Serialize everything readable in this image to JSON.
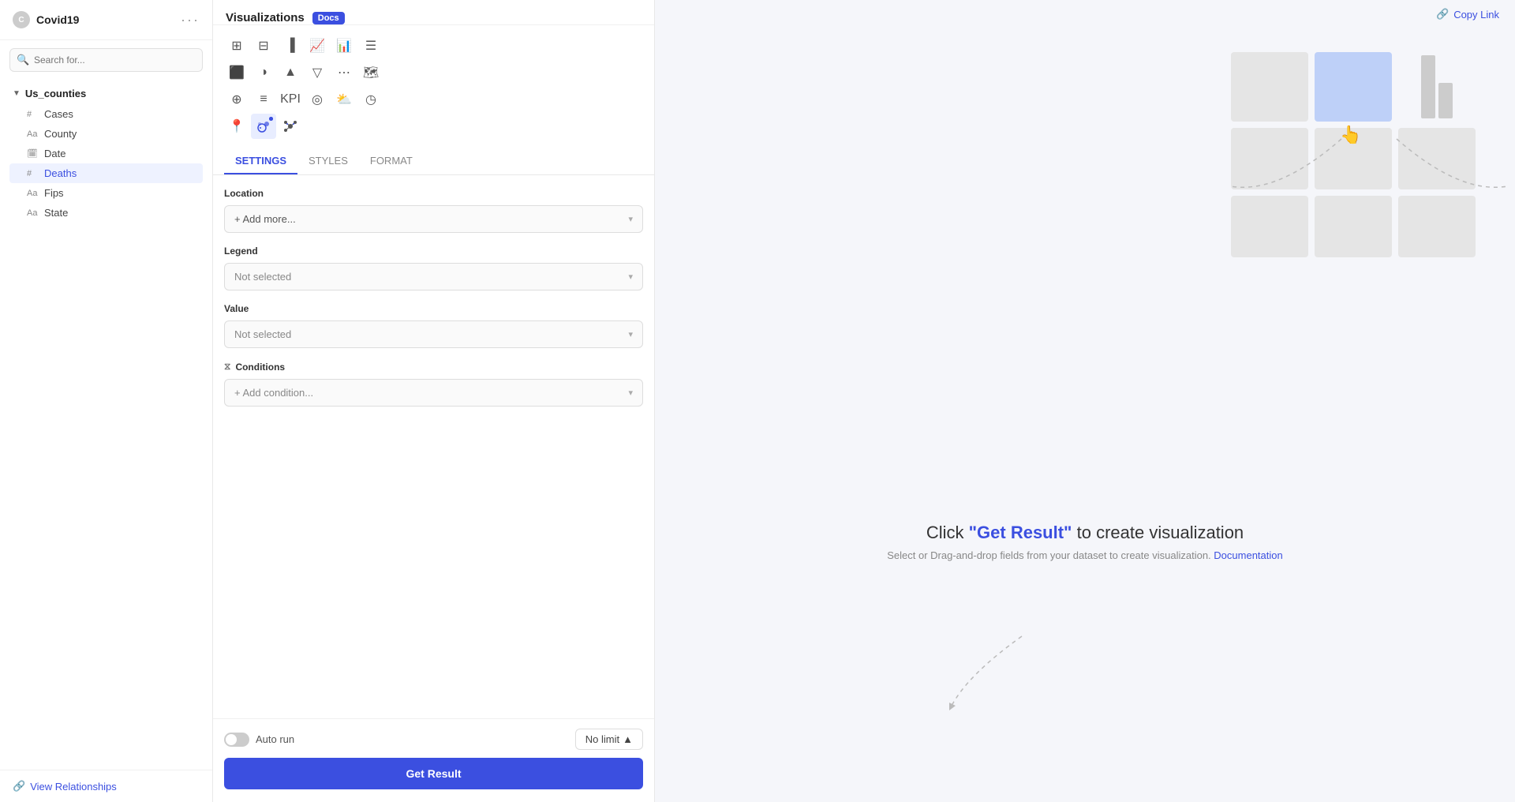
{
  "app": {
    "title": "Covid19",
    "more_icon": "···"
  },
  "sidebar": {
    "search_placeholder": "Search for...",
    "dataset": "Us_counties",
    "fields": [
      {
        "name": "Cases",
        "type": "number",
        "icon": "#"
      },
      {
        "name": "County",
        "type": "text",
        "icon": "Aa"
      },
      {
        "name": "Date",
        "type": "date",
        "icon": "📅"
      },
      {
        "name": "Deaths",
        "type": "number",
        "icon": "#",
        "active": true
      },
      {
        "name": "Fips",
        "type": "text",
        "icon": "Aa"
      },
      {
        "name": "State",
        "type": "text",
        "icon": "Aa"
      }
    ],
    "view_relationships": "View Relationships"
  },
  "panel": {
    "title": "Visualizations",
    "docs_badge": "Docs",
    "tabs": [
      "SETTINGS",
      "STYLES",
      "FORMAT"
    ],
    "active_tab": "SETTINGS",
    "sections": {
      "location": {
        "label": "Location",
        "field": "+ Add more...",
        "placeholder": "+ Add more..."
      },
      "legend": {
        "label": "Legend",
        "placeholder": "Not selected"
      },
      "value": {
        "label": "Value",
        "placeholder": "Not selected"
      },
      "conditions": {
        "label": "Conditions",
        "placeholder": "+ Add condition..."
      }
    },
    "footer": {
      "auto_run": "Auto run",
      "no_limit": "No limit",
      "get_result": "Get Result"
    }
  },
  "canvas": {
    "copy_link": "Copy Link",
    "center_message_prefix": "Click ",
    "center_message_highlight": "\"Get Result\"",
    "center_message_suffix": " to create visualization",
    "sub_message": "Select or Drag-and-drop fields from your dataset to create visualization.",
    "documentation_link": "Documentation"
  }
}
